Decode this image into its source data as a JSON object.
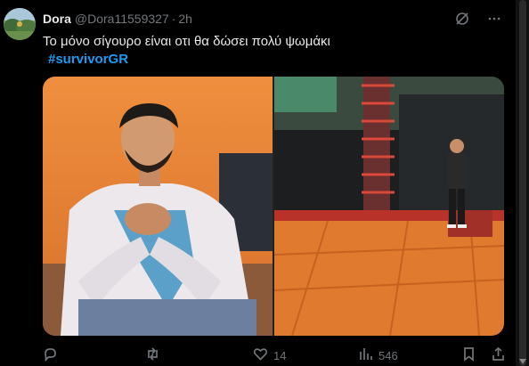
{
  "author": {
    "name": "Dora",
    "handle": "@Dora11559327",
    "dot": "·",
    "time": "2h"
  },
  "post": {
    "text": "Το μόνο σίγουρο είναι οτι θα δώσει πολύ ψωμάκι",
    "hashtag": "#survivorGR"
  },
  "media": {
    "left": {
      "alt": "man-in-white-jacket-photo"
    },
    "right": {
      "alt": "man-on-stage-photo"
    }
  },
  "actions": {
    "reply_count": "",
    "retweet_count": "",
    "like_count": "14",
    "view_count": "546"
  },
  "colors": {
    "background": "#000000",
    "text": "#e7e9ea",
    "muted": "#71767b",
    "link": "#1d9bf0"
  },
  "icons": [
    "grok-icon",
    "more-icon",
    "reply-icon",
    "retweet-icon",
    "like-icon",
    "views-icon",
    "bookmark-icon",
    "share-icon"
  ]
}
